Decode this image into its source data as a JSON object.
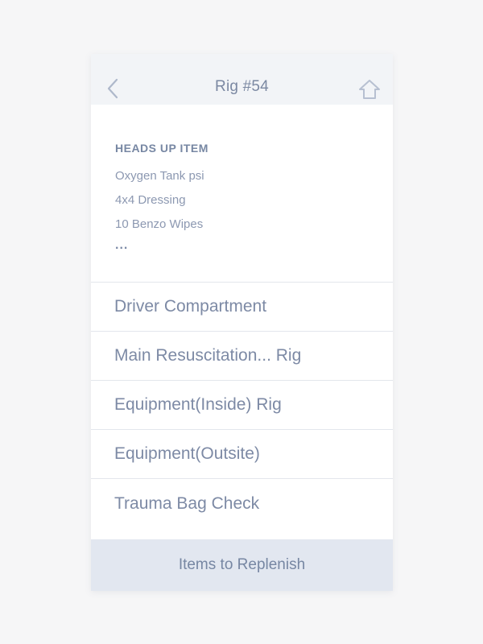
{
  "header": {
    "title": "Rig #54",
    "back_icon": "chevron-left-icon",
    "home_icon": "home-icon"
  },
  "heads_up": {
    "title": "HEADS UP ITEM",
    "items": [
      "Oxygen Tank psi",
      "4x4 Dressing",
      "10 Benzo Wipes"
    ],
    "more": "..."
  },
  "menu": {
    "items": [
      "Driver Compartment",
      "Main Resuscitation... Rig",
      "Equipment(Inside) Rig",
      "Equipment(Outsite)",
      "Trauma Bag Check"
    ]
  },
  "footer": {
    "button_label": "Items to Replenish"
  },
  "colors": {
    "accent": "#7c8aa6",
    "header_bg": "#f2f4f7",
    "footer_bg": "#e2e7f0"
  }
}
